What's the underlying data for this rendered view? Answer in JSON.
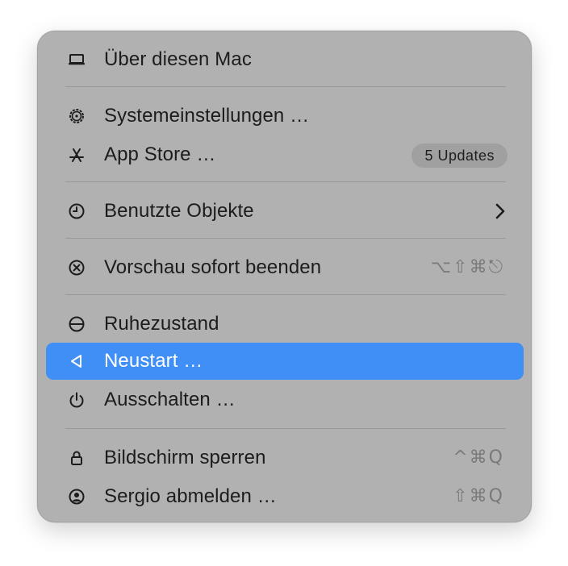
{
  "menu": {
    "about": {
      "label": "Über diesen Mac",
      "icon": "laptop-icon"
    },
    "settings": {
      "label": "Systemeinstellungen …",
      "icon": "gear-icon"
    },
    "appstore": {
      "label": "App Store …",
      "icon": "app-store-icon",
      "badge": "5 Updates"
    },
    "recent": {
      "label": "Benutzte Objekte",
      "icon": "clock-icon",
      "chevron": "›"
    },
    "forcequit": {
      "label": "Vorschau sofort beenden",
      "icon": "force-quit-icon",
      "shortcut": "⌥⇧⌘⎋"
    },
    "sleep": {
      "label": "Ruhezustand",
      "icon": "sleep-icon"
    },
    "restart": {
      "label": "Neustart …",
      "icon": "restart-icon",
      "selected": true
    },
    "shutdown": {
      "label": "Ausschalten …",
      "icon": "power-icon"
    },
    "lock": {
      "label": "Bildschirm sperren",
      "icon": "lock-icon",
      "shortcut": "^⌘Q"
    },
    "logout": {
      "label": "Sergio abmelden …",
      "icon": "user-icon",
      "shortcut": "⇧⌘Q"
    }
  },
  "colors": {
    "menu_background": "#b1b1b1",
    "selection": "#3f8ff6",
    "separator": "#9a9a9a"
  }
}
